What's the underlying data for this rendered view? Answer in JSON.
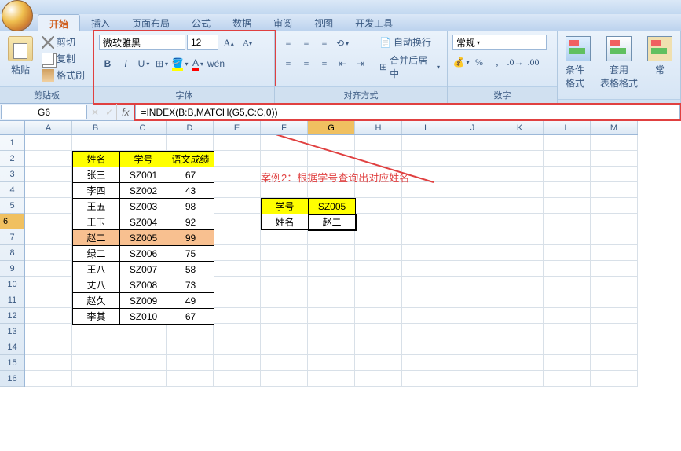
{
  "tabs": {
    "active": "开始",
    "items": [
      "开始",
      "插入",
      "页面布局",
      "公式",
      "数据",
      "审阅",
      "视图",
      "开发工具"
    ]
  },
  "clipboard": {
    "label": "剪贴板",
    "paste": "粘贴",
    "cut": "剪切",
    "copy": "复制",
    "brush": "格式刷"
  },
  "font": {
    "label": "字体",
    "family": "微软雅黑",
    "size": "12"
  },
  "align": {
    "label": "对齐方式",
    "wrap": "自动换行",
    "merge": "合并后居中"
  },
  "number": {
    "label": "数字",
    "format": "常规"
  },
  "styles": {
    "cond": "条件格式",
    "table": "套用\n表格格式"
  },
  "namebox": "G6",
  "formula": "=INDEX(B:B,MATCH(G5,C:C,0))",
  "cols": [
    "A",
    "B",
    "C",
    "D",
    "E",
    "F",
    "G",
    "H",
    "I",
    "J",
    "K",
    "L",
    "M"
  ],
  "rownums": [
    "1",
    "2",
    "3",
    "4",
    "5",
    "6",
    "7",
    "8",
    "9",
    "10",
    "11",
    "12",
    "13",
    "14",
    "15",
    "16"
  ],
  "table": {
    "headers": [
      "姓名",
      "学号",
      "语文成绩"
    ],
    "rows": [
      [
        "张三",
        "SZ001",
        "67"
      ],
      [
        "李四",
        "SZ002",
        "43"
      ],
      [
        "王五",
        "SZ003",
        "98"
      ],
      [
        "王玉",
        "SZ004",
        "92"
      ],
      [
        "赵二",
        "SZ005",
        "99"
      ],
      [
        "绿二",
        "SZ006",
        "75"
      ],
      [
        "王八",
        "SZ007",
        "58"
      ],
      [
        "丈八",
        "SZ008",
        "73"
      ],
      [
        "赵久",
        "SZ009",
        "49"
      ],
      [
        "李其",
        "SZ010",
        "67"
      ]
    ],
    "highlight_row": 4
  },
  "lookup": {
    "k1": "学号",
    "v1": "SZ005",
    "k2": "姓名",
    "v2": "赵二"
  },
  "annotation": "案例2：根据学号查询出对应姓名"
}
